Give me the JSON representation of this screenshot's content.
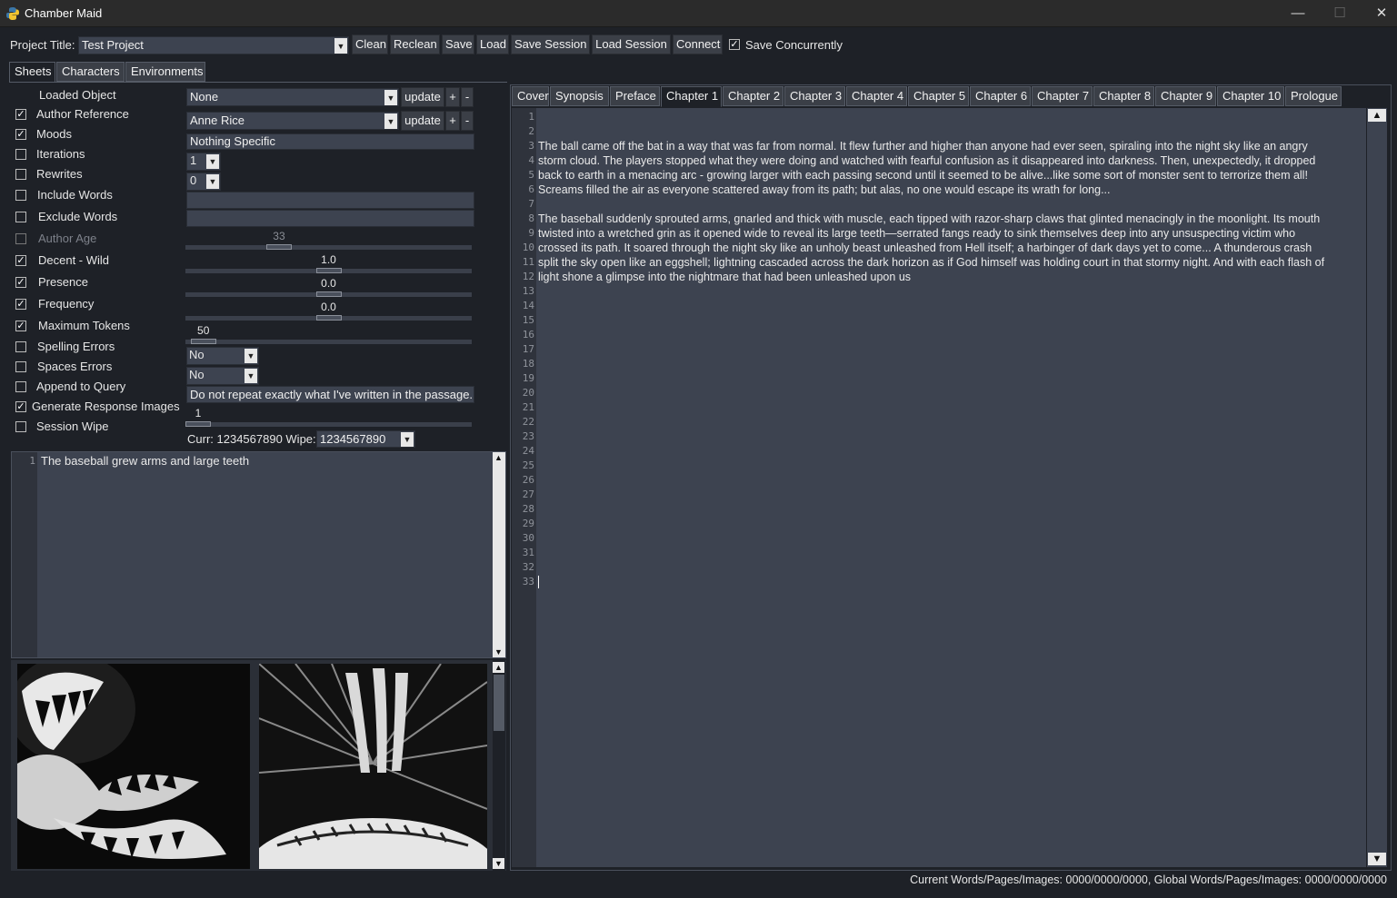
{
  "window": {
    "title": "Chamber Maid",
    "min": "—",
    "max": "☐",
    "close": "✕"
  },
  "toolbar": {
    "project_label": "Project Title:",
    "project_value": "Test Project",
    "buttons": [
      "Clean",
      "Reclean",
      "Save",
      "Load",
      "Save Session",
      "Load Session",
      "Connect"
    ],
    "save_concurrently_label": "Save Concurrently",
    "save_concurrently_checked": true
  },
  "left_tabs": [
    "Sheets",
    "Characters",
    "Environments"
  ],
  "sheet": {
    "loaded_object_label": "Loaded Object",
    "loaded_object_value": "None",
    "author_reference_label": "Author Reference",
    "author_reference_value": "Anne Rice",
    "update_label": "update",
    "plus": "+",
    "minus": "-",
    "moods_label": "Moods",
    "moods_value": "Nothing Specific",
    "iterations_label": "Iterations",
    "iterations_value": "1",
    "rewrites_label": "Rewrites",
    "rewrites_value": "0",
    "include_words_label": "Include Words",
    "exclude_words_label": "Exclude Words",
    "author_age_label": "Author Age",
    "author_age_value": "33",
    "decent_wild_label": "Decent - Wild",
    "decent_wild_value": "1.0",
    "presence_label": "Presence",
    "presence_value": "0.0",
    "frequency_label": "Frequency",
    "frequency_value": "0.0",
    "max_tokens_label": "Maximum Tokens",
    "max_tokens_value": "50",
    "spelling_errors_label": "Spelling Errors",
    "spelling_errors_value": "No",
    "spaces_errors_label": "Spaces Errors",
    "spaces_errors_value": "No",
    "append_query_label": "Append to Query",
    "append_query_value": "Do not repeat exactly what I've written in the passage. `",
    "gen_images_label": "Generate Response Images",
    "gen_images_value": "1",
    "session_wipe_label": "Session Wipe",
    "curr_label": "Curr: 1234567890 Wipe:",
    "wipe_value": "1234567890",
    "checks": {
      "author_reference": true,
      "moods": true,
      "iterations": false,
      "rewrites": false,
      "include_words": false,
      "exclude_words": false,
      "author_age": false,
      "decent_wild": true,
      "presence": true,
      "frequency": true,
      "max_tokens": true,
      "spelling_errors": false,
      "spaces_errors": false,
      "append_query": false,
      "gen_images": true,
      "session_wipe": false
    },
    "slider_levels": {
      "author_age": 0.31,
      "decent_wild": 0.5,
      "presence": 0.5,
      "frequency": 0.5,
      "max_tokens": 0.02,
      "gen_images": 0.0
    }
  },
  "prompt_editor": {
    "line_numbers": [
      "1"
    ],
    "text": "The baseball grew arms and large teeth"
  },
  "right_tabs": [
    "Cover",
    "Synopsis",
    "Preface",
    "Chapter 1",
    "Chapter 2",
    "Chapter 3",
    "Chapter 4",
    "Chapter 5",
    "Chapter 6",
    "Chapter 7",
    "Chapter 8",
    "Chapter 9",
    "Chapter 10",
    "Prologue"
  ],
  "right_active_tab": "Chapter 1",
  "chapter": {
    "line_count": 33,
    "lines": [
      "",
      "",
      "The ball came off the bat in a way that was far from normal. It flew further and higher than anyone had ever seen, spiraling into the night sky like an angry",
      "storm cloud. The players stopped what they were doing and watched with fearful confusion as it disappeared into darkness. Then, unexpectedly, it dropped",
      "back to earth in a menacing arc - growing larger with each passing second until it seemed to be alive...like some sort of monster sent to terrorize them all!",
      "Screams filled the air as everyone scattered away from its path; but alas, no one would escape its wrath for long...",
      "",
      "The baseball suddenly sprouted arms, gnarled and thick with muscle, each tipped with razor-sharp claws that glinted menacingly in the moonlight. Its mouth",
      "twisted into a wretched grin as it opened wide to reveal its large teeth—serrated fangs ready to sink themselves deep into any unsuspecting victim who",
      "crossed its path. It soared through the night sky like an unholy beast unleashed from Hell itself; a harbinger of dark days yet to come... A thunderous crash",
      "split the sky open like an eggshell; lightning cascaded across the dark horizon as if God himself was holding court in that stormy night. And with each flash of",
      "light shone a glimpse into the nightmare that had been unleashed upon us"
    ]
  },
  "status": "Current Words/Pages/Images: 0000/0000/0000, Global Words/Pages/Images: 0000/0000/0000",
  "colors": {
    "bg": "#1e2127",
    "field": "#3d4350",
    "gutter": "#2f333c",
    "titlebar": "#2b2b2b"
  }
}
